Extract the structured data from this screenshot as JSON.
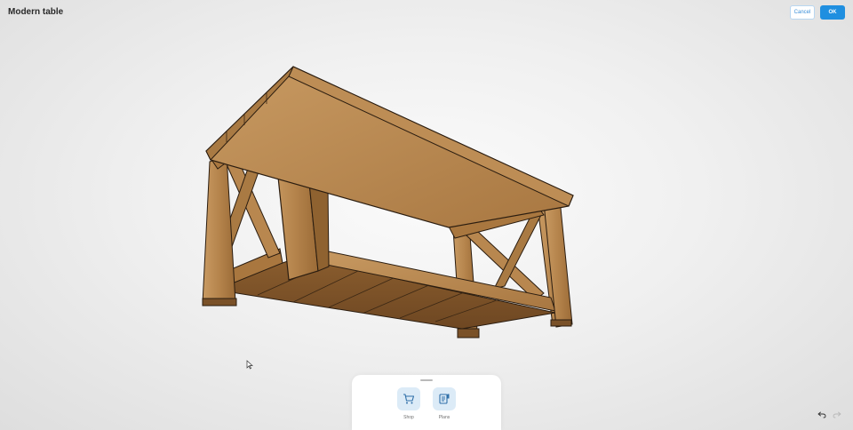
{
  "header": {
    "title": "Modern table",
    "cancel_label": "Cancel",
    "ok_label": "OK"
  },
  "toolbar": {
    "items": [
      {
        "label": "Shop",
        "icon": "cart-icon"
      },
      {
        "label": "Plans",
        "icon": "plans-icon"
      }
    ]
  },
  "history": {
    "undo_icon": "undo-icon",
    "redo_icon": "redo-icon"
  },
  "colors": {
    "accent": "#1f8fe0",
    "wood": "#b07f47",
    "background": "#f0f0f0"
  }
}
